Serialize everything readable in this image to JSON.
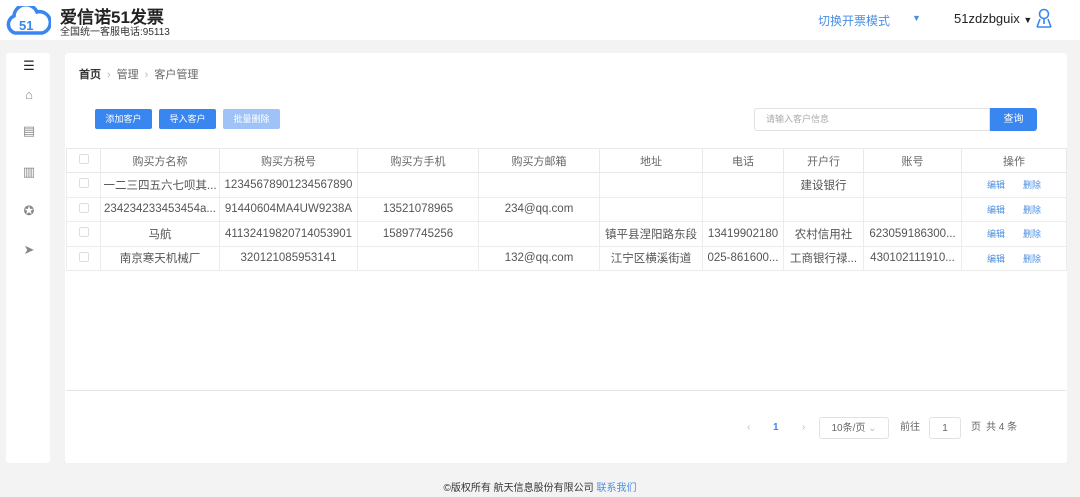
{
  "header": {
    "brand": "爱信诺51发票",
    "hotline": "全国统一客服电话:95113",
    "mode_switch": "切换开票模式",
    "username": "51zdzbguix",
    "brand_color": "#3a86f0"
  },
  "breadcrumb": {
    "home": "首页",
    "level1": "管理",
    "current": "客户管理"
  },
  "toolbar": {
    "add": "添加客户",
    "import": "导入客户",
    "batch_delete": "批量删除",
    "search_placeholder": "请输入客户信息",
    "search_button": "查询"
  },
  "table": {
    "headers": [
      "购买方名称",
      "购买方税号",
      "购买方手机",
      "购买方邮箱",
      "地址",
      "电话",
      "开户行",
      "账号",
      "操作"
    ],
    "rows": [
      [
        "一二三四五六七呗其...",
        "12345678901234567890",
        "",
        "",
        "",
        "",
        "建设银行",
        ""
      ],
      [
        "234234233453454a...",
        "91440604MA4UW9238A",
        "13521078965",
        "234@qq.com",
        "",
        "",
        "",
        ""
      ],
      [
        "马航",
        "41132419820714053901",
        "15897745256",
        "",
        "镇平县涅阳路东段",
        "13419902180",
        "农村信用社",
        "623059186300..."
      ],
      [
        "南京寒天机械厂",
        "320121085953141",
        "",
        "132@qq.com",
        "江宁区横溪街道",
        "025-861600...",
        "工商银行禄...",
        "430102111910..."
      ]
    ],
    "edit": "编辑",
    "delete": "删除"
  },
  "pagination": {
    "current_page": "1",
    "page_size": "10条/页",
    "goto_label": "前往",
    "goto_value": "1",
    "page_suffix": "页",
    "total": "共 4 条"
  },
  "footer": {
    "copyright": "©版权所有 航天信息股份有限公司",
    "contact": "联系我们"
  }
}
